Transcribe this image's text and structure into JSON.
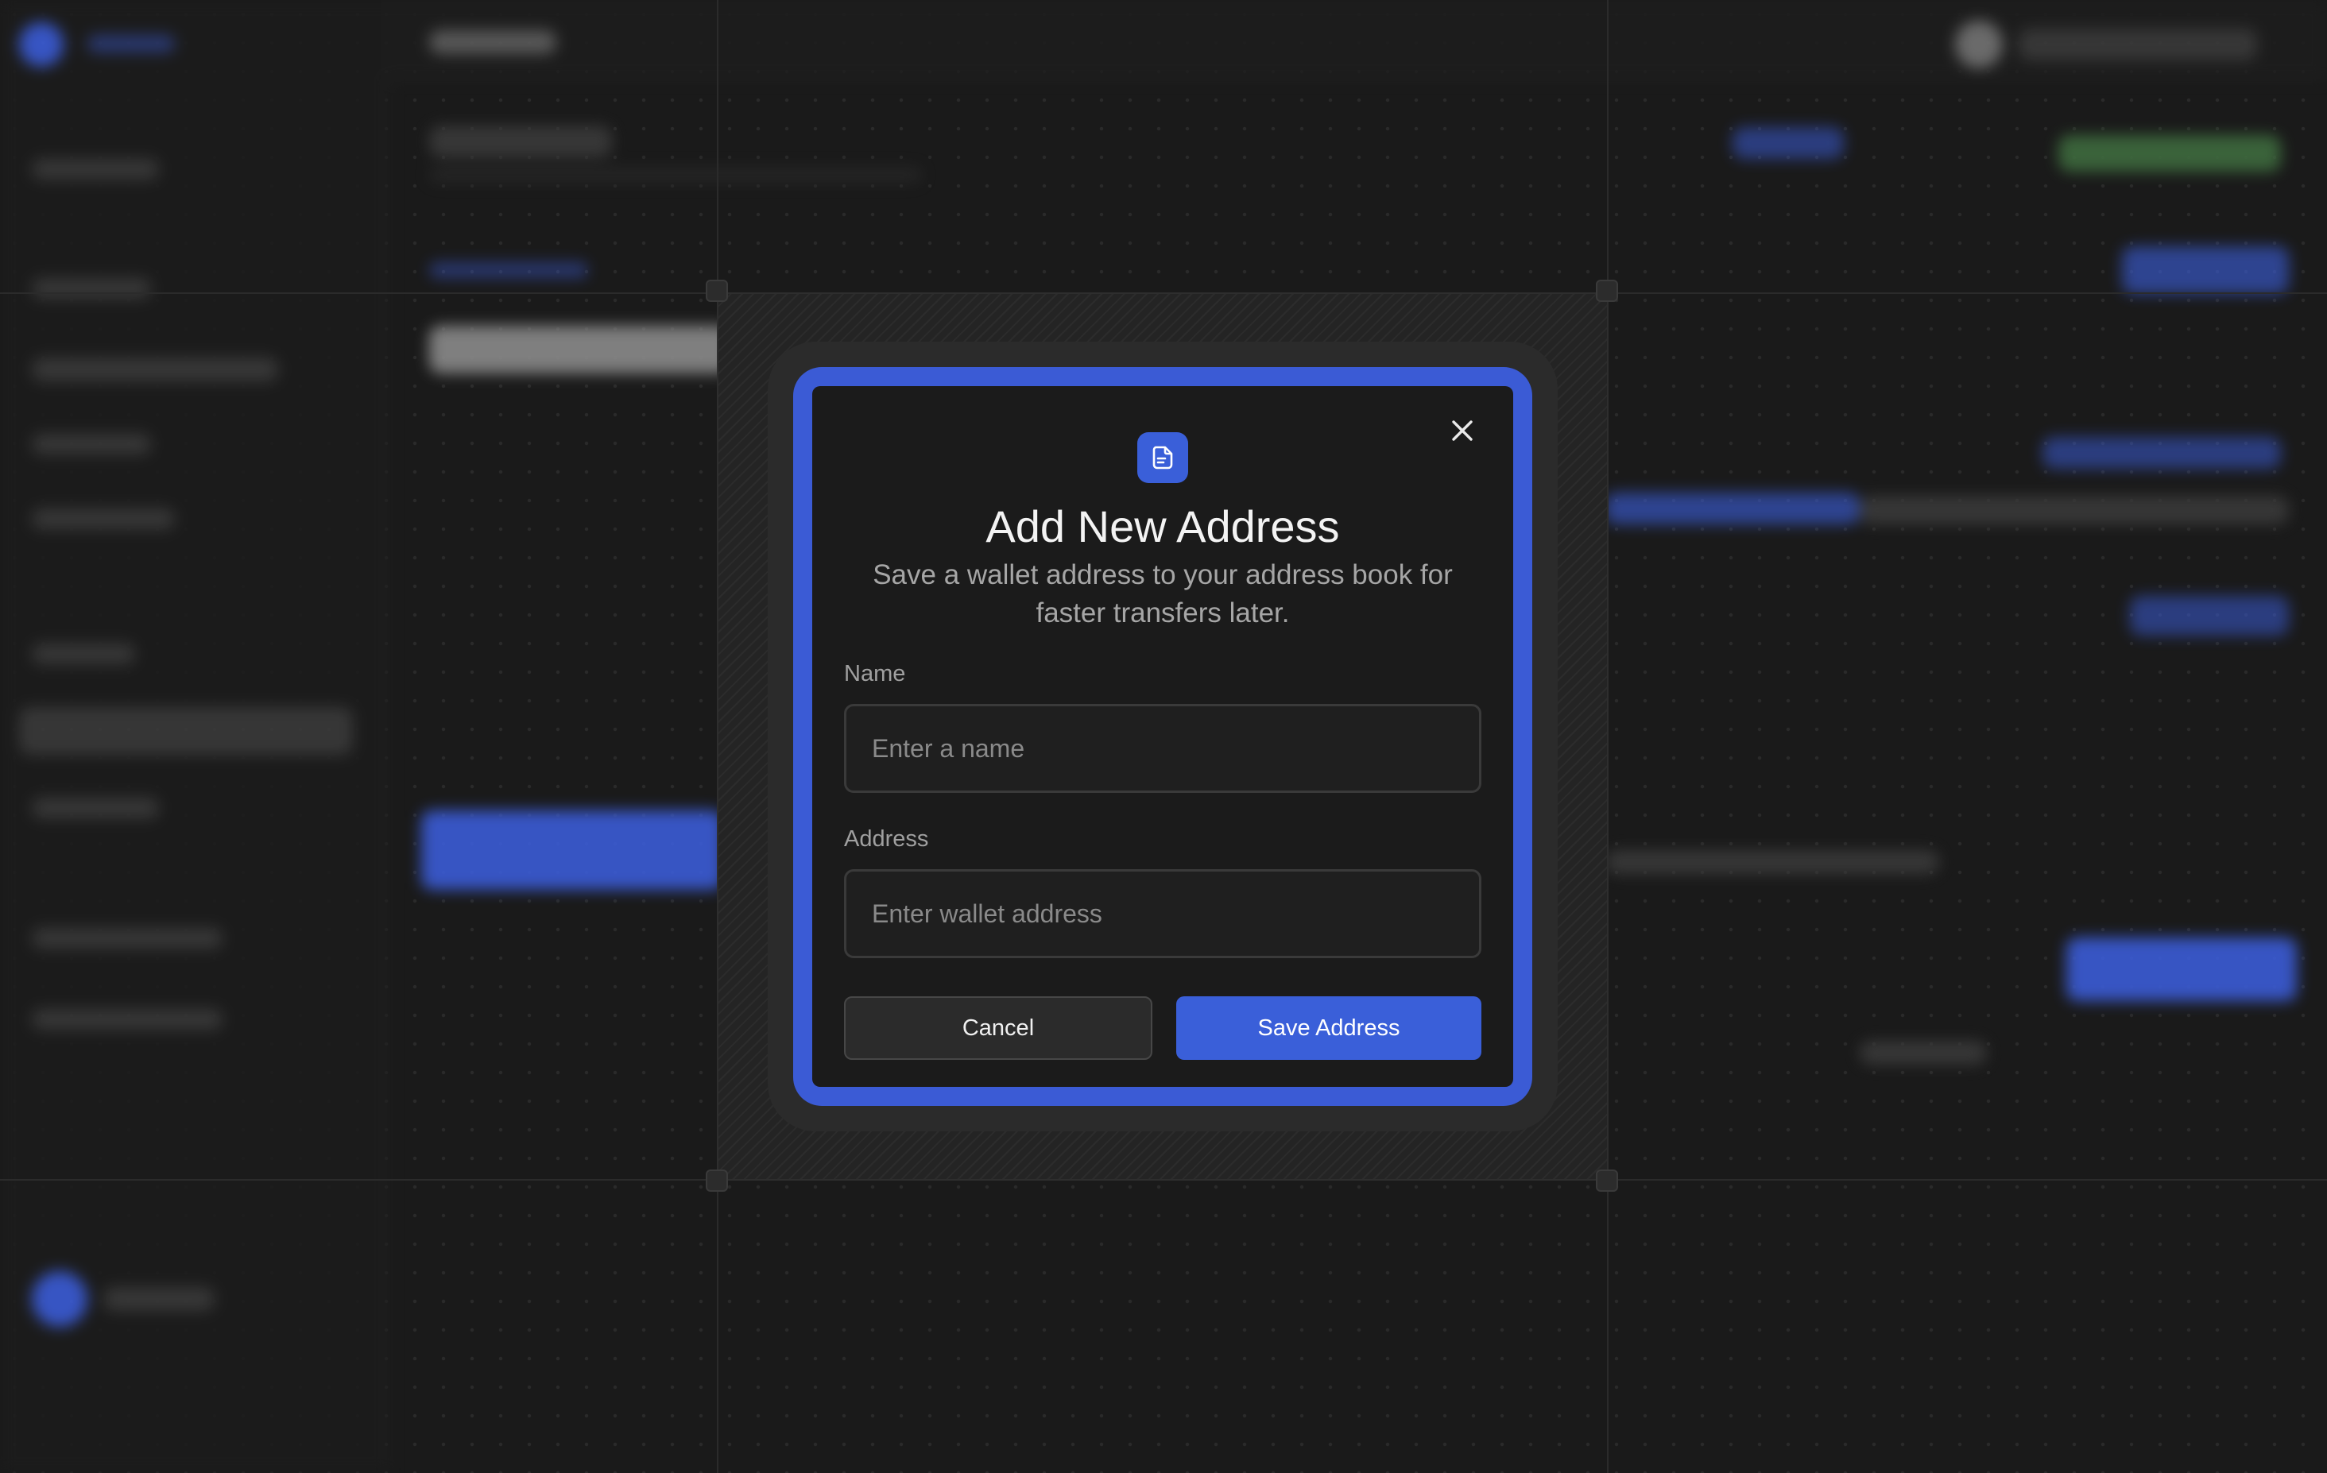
{
  "dialog": {
    "title": "Add New Address",
    "subtitle": "Save a wallet address to your address book for faster transfers later.",
    "icon": "document-icon",
    "close_icon": "close-icon",
    "name_label": "Name",
    "name_placeholder": "Enter a name",
    "name_value": "",
    "address_label": "Address",
    "address_placeholder": "Enter wallet address",
    "address_value": "",
    "cancel_label": "Cancel",
    "save_label": "Save Address"
  },
  "colors": {
    "accent": "#3a5fd9",
    "dialog_bg": "#1b1b1b",
    "page_bg": "#1a1a1a"
  }
}
